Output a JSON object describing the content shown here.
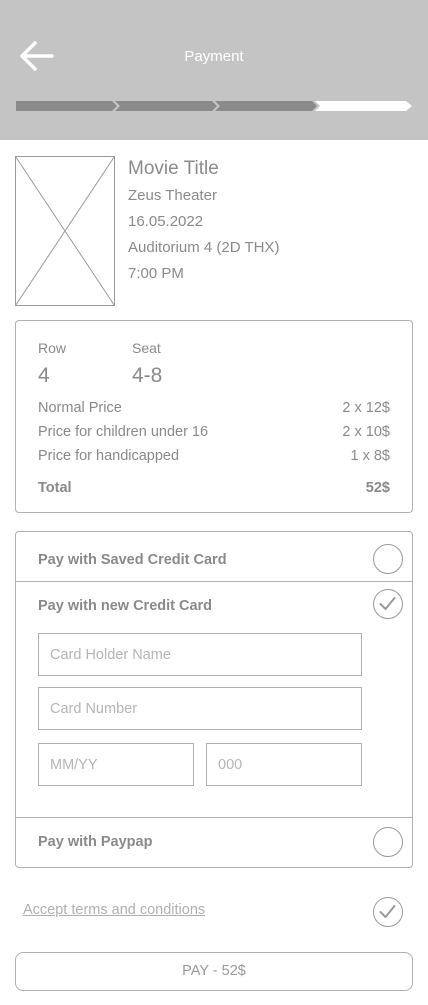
{
  "header": {
    "title": "Payment",
    "progress_steps": [
      {
        "done": true
      },
      {
        "done": true
      },
      {
        "done": true
      },
      {
        "done": false
      }
    ]
  },
  "movie": {
    "title": "Movie Title",
    "theater": "Zeus Theater",
    "date": "16.05.2022",
    "auditorium": "Auditorium 4 (2D THX)",
    "time": "7:00 PM"
  },
  "ticket": {
    "row_label": "Row",
    "row_value": "4",
    "seat_label": "Seat",
    "seat_value": "4-8",
    "prices": [
      {
        "label": "Normal Price",
        "value": "2 x 12$"
      },
      {
        "label": "Price for children under 16",
        "value": "2 x 10$"
      },
      {
        "label": "Price for handicapped",
        "value": "1 x 8$"
      }
    ],
    "total_label": "Total",
    "total_value": "52$"
  },
  "payment": {
    "saved_card_label": "Pay with Saved Credit Card",
    "saved_card_selected": false,
    "new_card_label": "Pay with new Credit Card",
    "new_card_selected": true,
    "card_holder_placeholder": "Card Holder Name",
    "card_number_placeholder": "Card Number",
    "expiry_placeholder": "MM/YY",
    "cvc_placeholder": "000",
    "paypal_label": "Pay with Paypap",
    "paypal_selected": false
  },
  "terms": {
    "label": "Accept terms and conditions",
    "accepted": true
  },
  "pay_button": {
    "label": "PAY - 52$"
  }
}
